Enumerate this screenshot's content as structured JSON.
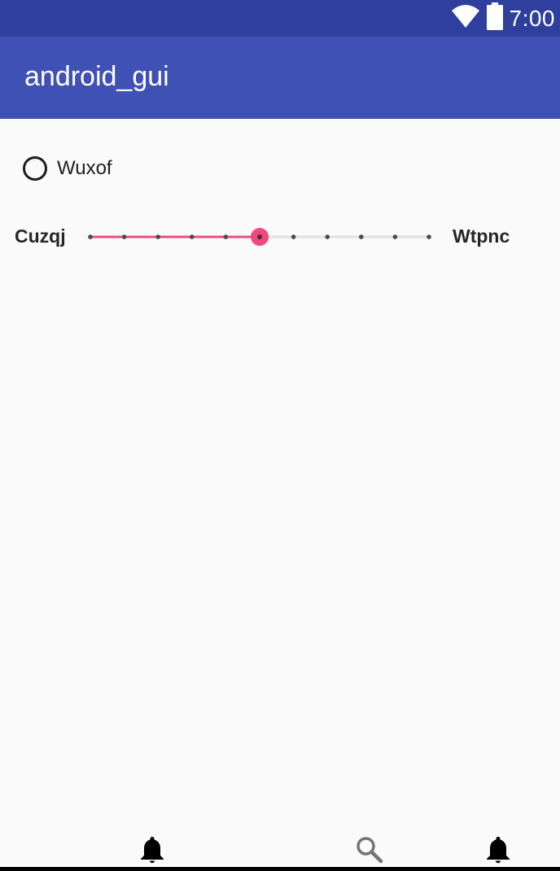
{
  "status_bar": {
    "time": "7:00",
    "wifi_icon": "wifi-icon",
    "battery_icon": "battery-icon"
  },
  "app_bar": {
    "title": "android_gui"
  },
  "radio": {
    "label": "Wuxof",
    "checked": false
  },
  "seekbar": {
    "left_label": "Cuzqj",
    "right_label": "Wtpnc",
    "min": 0,
    "max": 10,
    "value": 5,
    "active_color": "#e94c81",
    "thumb_color": "#f0487f",
    "track_color": "#e0e0e0",
    "tick_color": "#4a4a4a"
  },
  "bottom_nav": {
    "items": [
      {
        "icon": "bell-icon"
      },
      {
        "icon": "search-icon"
      },
      {
        "icon": "bell-icon"
      }
    ]
  },
  "colors": {
    "status_bar": "#2f3f9e",
    "app_bar": "#3f51b5",
    "background": "#fafafa"
  }
}
